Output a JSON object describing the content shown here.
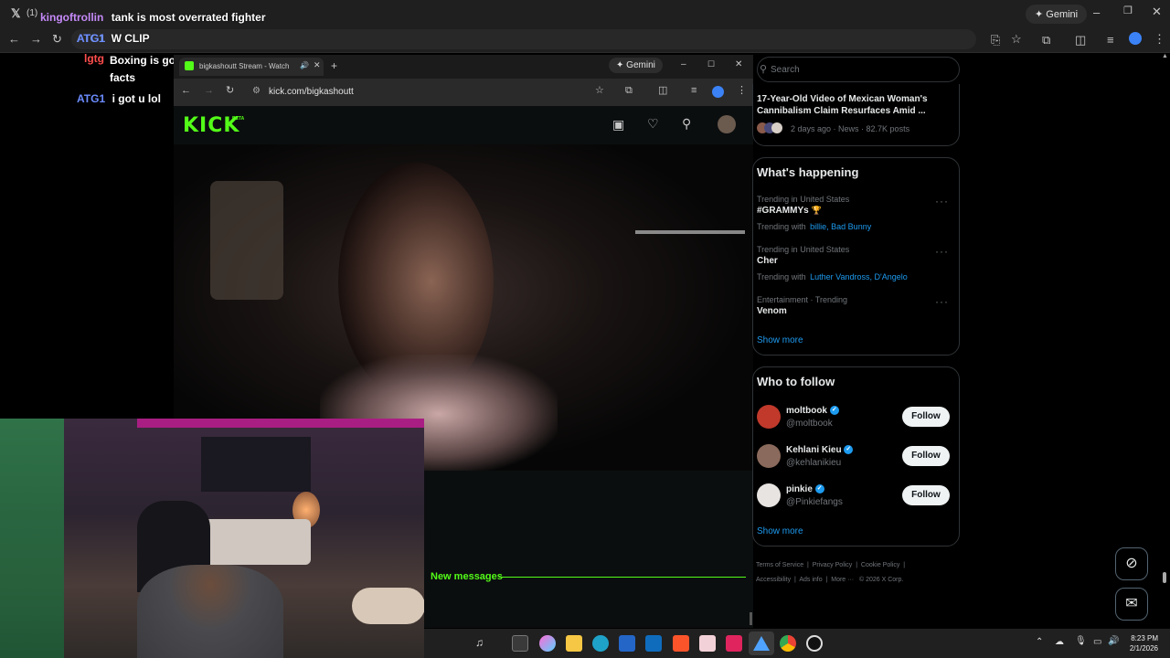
{
  "outer_browser": {
    "tab_badge": "(1)",
    "gemini_label": "Gemini",
    "address_overlap_text": "ATG1"
  },
  "chat_overlay": [
    {
      "user": "kingoftrollin",
      "user_color": "#c58af9",
      "message": "tank is most overrated fighter"
    },
    {
      "user": "ATG1",
      "user_color": "#6b8cff",
      "message": "W CLIP"
    },
    {
      "user": "lgtg",
      "user_color": "#ff4d4d",
      "message": "Boxing is going up because Jake Paul and thats facts"
    },
    {
      "user": "ATG1",
      "user_color": "#6b8cff",
      "message": "i got u lol"
    }
  ],
  "inner_browser": {
    "tab_title": "bigkashoutt Stream - Watch",
    "gemini_label": "Gemini",
    "url": "kick.com/bigkashoutt",
    "new_tab_icon": "plus-icon"
  },
  "kick": {
    "logo": "KICK",
    "logo_badge": "BETA",
    "brand_color": "#53fc18",
    "new_messages": "New messages"
  },
  "x_sidebar": {
    "search_placeholder": "Search",
    "top_card": {
      "title": "17-Year-Old Video of Mexican Woman's Cannibalism Claim Resurfaces Amid ...",
      "meta": "2 days ago · News · 82.7K posts"
    },
    "happening": {
      "heading": "What's happening",
      "items": [
        {
          "context": "Trending in United States",
          "title": "#GRAMMYs",
          "with_label": "Trending with",
          "with_links": "billie, Bad Bunny"
        },
        {
          "context": "Trending in United States",
          "title": "Cher",
          "with_label": "Trending with",
          "with_links": "Luther Vandross, D'Angelo"
        },
        {
          "context": "Entertainment · Trending",
          "title": "Venom",
          "with_label": "",
          "with_links": ""
        }
      ],
      "show_more": "Show more"
    },
    "who_to_follow": {
      "heading": "Who to follow",
      "accounts": [
        {
          "name": "moltbook",
          "handle": "@moltbook",
          "button": "Follow",
          "avatar_color": "#c0392b"
        },
        {
          "name": "Kehlani Kieu",
          "handle": "@kehlanikieu",
          "button": "Follow",
          "avatar_color": "#8a6a5c"
        },
        {
          "name": "pinkie",
          "handle": "@Pinkiefangs",
          "button": "Follow",
          "avatar_color": "#e8e4e2"
        }
      ],
      "show_more": "Show more"
    },
    "footer": {
      "links": [
        "Terms of Service",
        "Privacy Policy",
        "Cookie Policy",
        "Accessibility",
        "Ads info",
        "More ···"
      ],
      "copyright": "© 2026 X Corp."
    }
  },
  "taskbar": {
    "time": "8:23 PM",
    "date": "2/1/2026"
  }
}
